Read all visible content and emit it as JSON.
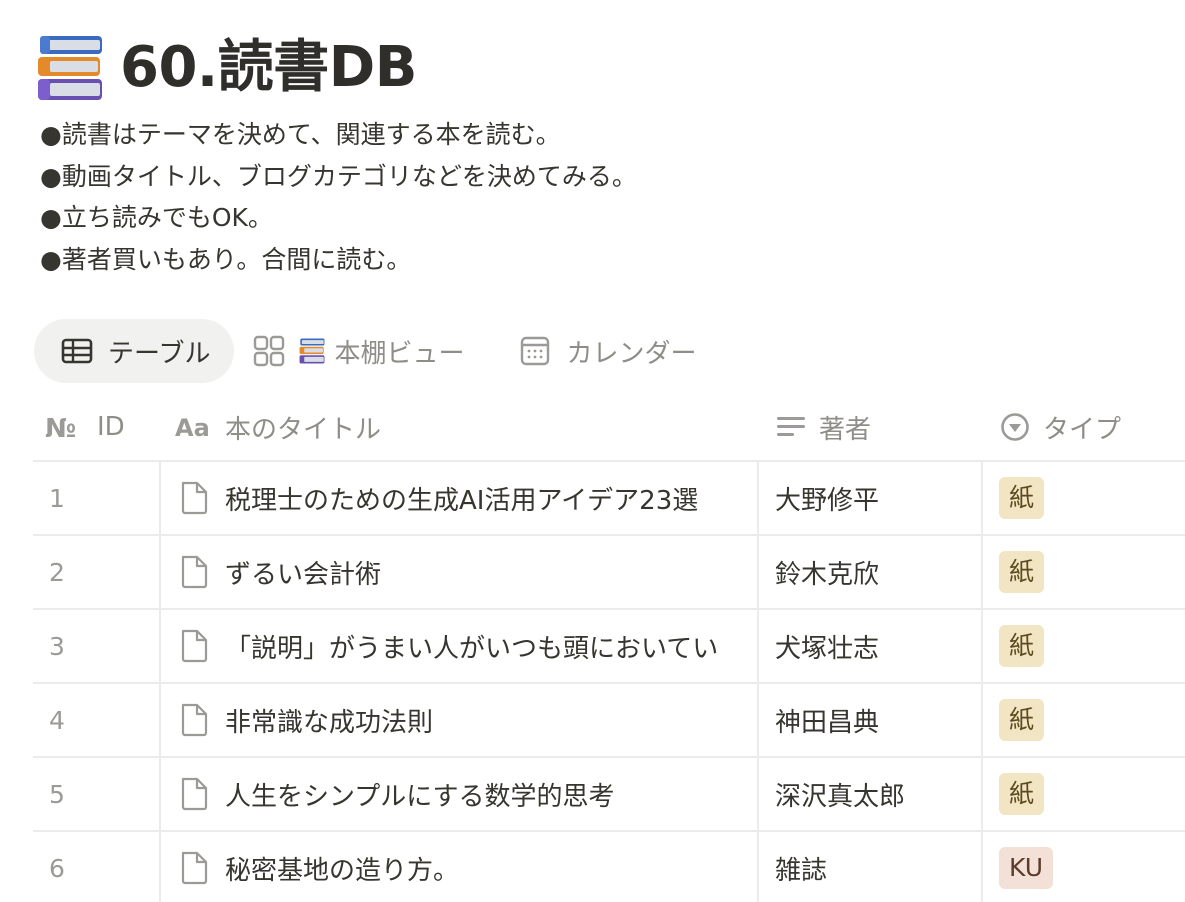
{
  "page": {
    "icon": "books-icon",
    "title": "60.読書DB",
    "description": [
      "●読書はテーマを決めて、関連する本を読む。",
      "●動画タイトル、ブログカテゴリなどを決めてみる。",
      "●立ち読みでもOK。",
      "●著者買いもあり。合間に読む。"
    ]
  },
  "views": [
    {
      "label": "テーブル",
      "icon": "table-icon",
      "active": true
    },
    {
      "label": "本棚ビュー",
      "icon": "gallery-grid-icon",
      "active": false
    },
    {
      "label": "カレンダー",
      "icon": "calendar-icon",
      "active": false
    }
  ],
  "table": {
    "columns": [
      {
        "label": "ID",
        "icon": "number-icon"
      },
      {
        "label": "本のタイトル",
        "icon": "title-text-icon"
      },
      {
        "label": "著者",
        "icon": "text-lines-icon"
      },
      {
        "label": "タイプ",
        "icon": "select-icon"
      }
    ],
    "rows": [
      {
        "id": "1",
        "title": "税理士のための生成AI活用アイデア23選",
        "author": "大野修平",
        "type": "紙"
      },
      {
        "id": "2",
        "title": "ずるい会計術",
        "author": "鈴木克欣",
        "type": "紙"
      },
      {
        "id": "3",
        "title": "「説明」がうまい人がいつも頭においてい",
        "author": "犬塚壮志",
        "type": "紙"
      },
      {
        "id": "4",
        "title": "非常識な成功法則",
        "author": "神田昌典",
        "type": "紙"
      },
      {
        "id": "5",
        "title": "人生をシンプルにする数学的思考",
        "author": "深沢真太郎",
        "type": "紙"
      },
      {
        "id": "6",
        "title": "秘密基地の造り方。",
        "author": "雑誌",
        "type": "KU"
      }
    ]
  },
  "colors": {
    "tag_paper_bg": "#f1e5c3",
    "tag_ku_bg": "#f3e1d8",
    "active_tab_bg": "#f1f1ef"
  }
}
